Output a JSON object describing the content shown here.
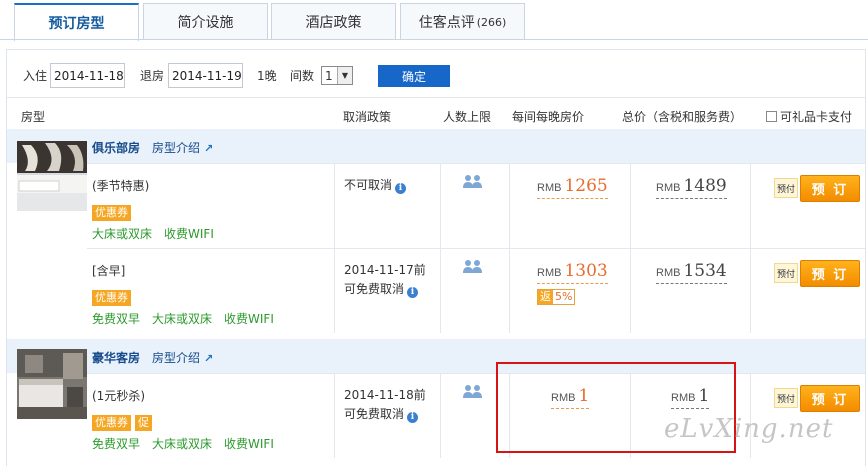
{
  "tabs": [
    {
      "label": "预订房型"
    },
    {
      "label": "简介设施"
    },
    {
      "label": "酒店政策"
    },
    {
      "label": "住客点评",
      "count": "(266)"
    }
  ],
  "search": {
    "checkin_label": "入住",
    "checkin_value": "2014-11-18",
    "checkout_label": "退房",
    "checkout_value": "2014-11-19",
    "nights": "1晚",
    "rooms_label": "间数",
    "rooms_value": "1",
    "confirm_label": "确定"
  },
  "columns": {
    "room_type": "房型",
    "cancel_policy": "取消政策",
    "max_people": "人数上限",
    "nightly_price": "每间每晚房价",
    "total_price": "总价（含税和服务费）",
    "gift_card": "可礼品卡支付"
  },
  "rooms": [
    {
      "name": "俱乐部房",
      "intro": "房型介绍",
      "rates": [
        {
          "title": "(季节特惠)",
          "badges": [
            "优惠券"
          ],
          "features": [
            "大床或双床",
            "收费WIFI"
          ],
          "policy_line1": "不可取消",
          "policy_line2": "",
          "currency": "RMB",
          "nightly": "1265",
          "total": "1489",
          "rebate": null
        },
        {
          "title": "[含早]",
          "badges": [
            "优惠券"
          ],
          "features": [
            "免费双早",
            "大床或双床",
            "收费WIFI"
          ],
          "policy_line1": "2014-11-17前",
          "policy_line2": "可免费取消",
          "currency": "RMB",
          "nightly": "1303",
          "total": "1534",
          "rebate": {
            "label": "返",
            "value": "5%"
          }
        }
      ]
    },
    {
      "name": "豪华客房",
      "intro": "房型介绍",
      "rates": [
        {
          "title": "(1元秒杀)",
          "badges": [
            "优惠券",
            "促"
          ],
          "features": [
            "免费双早",
            "大床或双床",
            "收费WIFI"
          ],
          "policy_line1": "2014-11-18前",
          "policy_line2": "可免费取消",
          "currency": "RMB",
          "nightly": "1",
          "total": "1",
          "rebate": null
        }
      ]
    }
  ],
  "book": {
    "tag": "预付",
    "button": "预 订"
  },
  "watermark": "eLvXing.net",
  "colors": {
    "accent": "#1767c9",
    "book_orange": "#f5a623",
    "price_orange": "#e86c2c",
    "feature_green": "#2c9a2c",
    "highlight_red": "#d61414"
  }
}
